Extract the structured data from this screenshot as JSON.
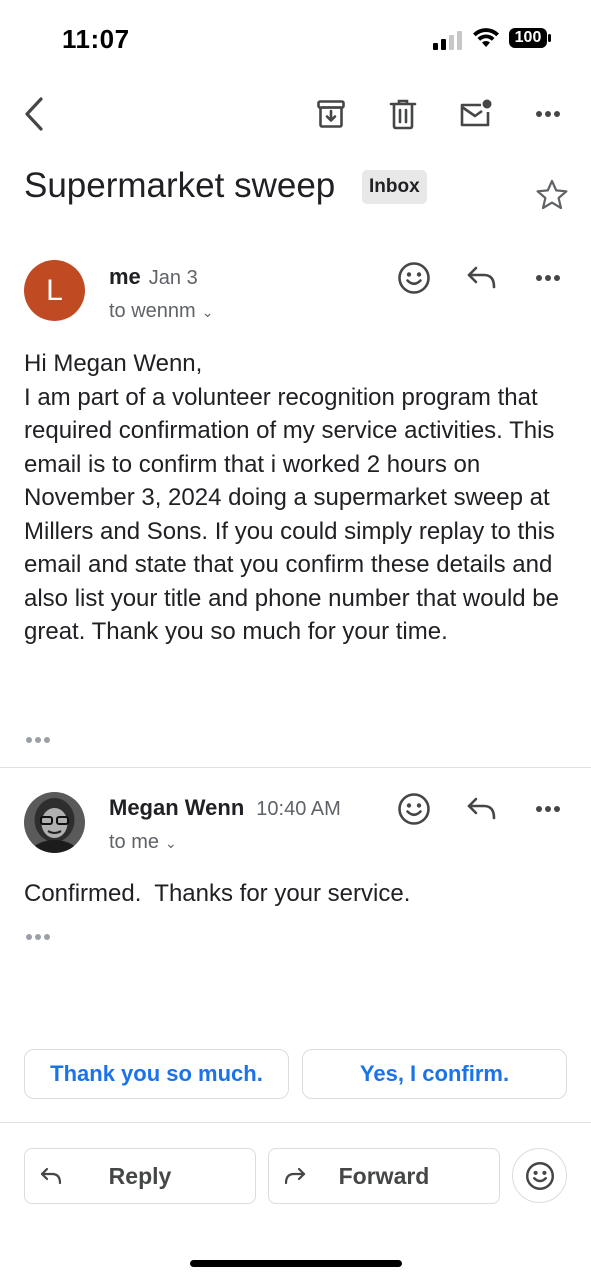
{
  "status_bar": {
    "time": "11:07",
    "battery": "100"
  },
  "toolbar": {
    "icons": [
      "back-arrow-icon",
      "archive-icon",
      "trash-icon",
      "mark-unread-icon",
      "more-icon"
    ]
  },
  "thread": {
    "subject": "Supermarket sweep",
    "label": "Inbox",
    "starred": false
  },
  "messages": [
    {
      "avatar_letter": "L",
      "avatar_color": "#c04b23",
      "sender": "me",
      "date": "Jan 3",
      "recipient": "to wennm",
      "body": "Hi Megan Wenn,\nI am part of a volunteer recognition program that required confirmation of my service activities. This email is to confirm that i worked 2 hours on November 3, 2024 doing a supermarket sweep at Millers and Sons. If you could simply replay to this email and state that you confirm these details and also list your title and phone number that would be great. Thank you so much for your time."
    },
    {
      "sender": "Megan Wenn",
      "date": "10:40 AM",
      "recipient": "to me",
      "body": "Confirmed.  Thanks for your service."
    }
  ],
  "smart_replies": [
    "Thank you so much.",
    "Yes, I confirm."
  ],
  "bottom_actions": {
    "reply_label": "Reply",
    "forward_label": "Forward"
  },
  "colors": {
    "accent": "#1a73e8",
    "text": "#202124",
    "secondary_text": "#5f6368"
  }
}
